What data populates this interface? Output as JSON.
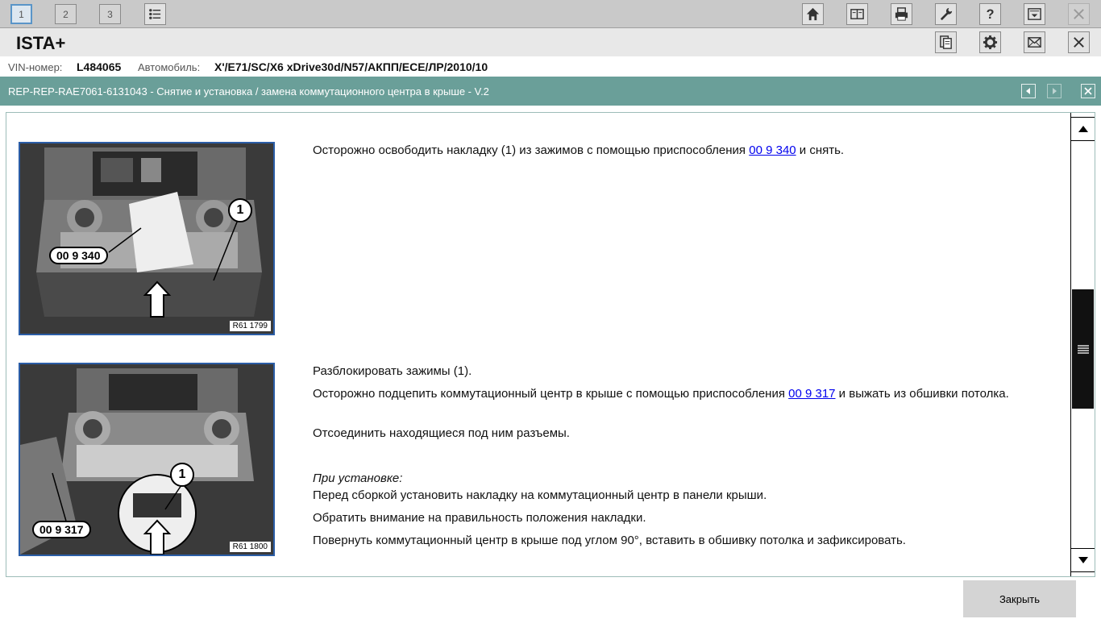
{
  "toolbar": {
    "tabs": [
      "1",
      "2",
      "3"
    ],
    "icons": [
      "list-icon",
      "home-icon",
      "book-icon",
      "printer-icon",
      "wrench-icon",
      "help-icon",
      "download-icon",
      "close-icon"
    ]
  },
  "app": {
    "title": "ISTA+",
    "icons": [
      "document-icon",
      "gear-icon",
      "mail-icon",
      "close-icon"
    ]
  },
  "info": {
    "vin_label": "VIN-номер:",
    "vin_value": "L484065",
    "car_label": "Автомобиль:",
    "car_value": "X'/E71/SC/X6 xDrive30d/N57/АКПП/ECE/ЛР/2010/10"
  },
  "doc": {
    "title": "REP-REP-RAE7061-6131043 - Снятие и установка / замена коммутационного центра в крыше - V.2",
    "nav": [
      "back-icon",
      "forward-icon",
      "close-icon"
    ]
  },
  "step1": {
    "figure_code": "R61 1799",
    "tool_tag": "00 9 340",
    "callout": "1",
    "text_before": "Осторожно освободить накладку (1) из зажимов с помощью приспособления ",
    "link": "00 9 340",
    "text_after": " и снять."
  },
  "step2": {
    "figure_code": "R61 1800",
    "tool_tag": "00 9 317",
    "callout": "1",
    "line1": "Разблокировать зажимы (1).",
    "line2_before": "Осторожно подцепить коммутационный центр в крыше с помощью приспособления ",
    "line2_link": "00 9 317",
    "line2_after": " и выжать из обшивки потолка.",
    "line3": "Отсоединить находящиеся под ним разъемы.",
    "install_heading": "При установке:",
    "line4": "Перед сборкой установить накладку на коммутационный центр в панели крыши.",
    "line5": "Обратить внимание на правильность положения накладки.",
    "line6": "Повернуть коммутационный центр в крыше под углом 90°, вставить в обшивку потолка и зафиксировать."
  },
  "footer": {
    "close_label": "Закрыть"
  }
}
